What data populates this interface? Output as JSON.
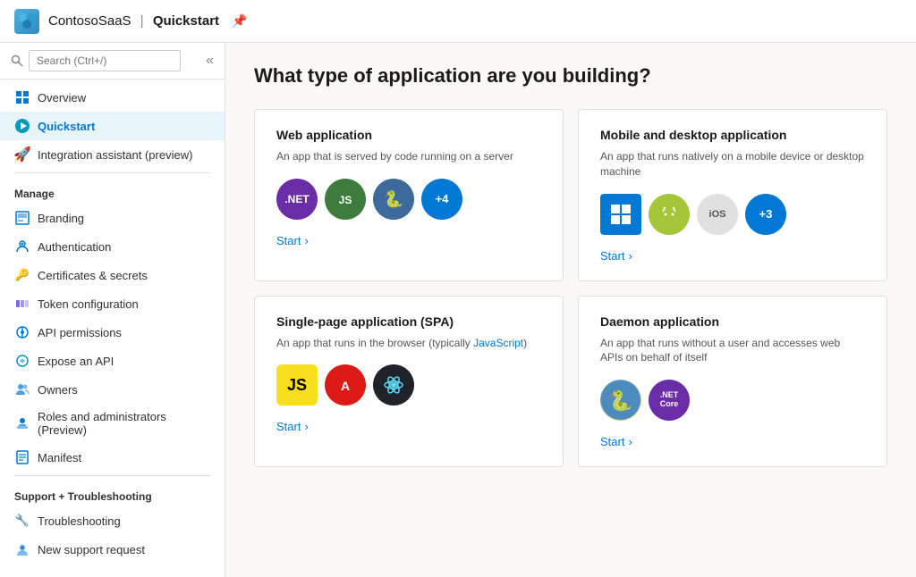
{
  "header": {
    "app_name": "ContosoSaaS",
    "separator": "|",
    "page_name": "Quickstart",
    "pin_icon": "📌"
  },
  "sidebar": {
    "search_placeholder": "Search (Ctrl+/)",
    "collapse_icon": "«",
    "items": [
      {
        "id": "overview",
        "label": "Overview",
        "icon": "grid",
        "active": false
      },
      {
        "id": "quickstart",
        "label": "Quickstart",
        "icon": "quickstart",
        "active": true
      },
      {
        "id": "integration",
        "label": "Integration assistant (preview)",
        "icon": "rocket",
        "active": false
      }
    ],
    "manage_label": "Manage",
    "manage_items": [
      {
        "id": "branding",
        "label": "Branding",
        "icon": "branding"
      },
      {
        "id": "authentication",
        "label": "Authentication",
        "icon": "auth"
      },
      {
        "id": "certificates",
        "label": "Certificates & secrets",
        "icon": "cert"
      },
      {
        "id": "token",
        "label": "Token configuration",
        "icon": "token"
      },
      {
        "id": "api-permissions",
        "label": "API permissions",
        "icon": "api"
      },
      {
        "id": "expose-api",
        "label": "Expose an API",
        "icon": "expose"
      },
      {
        "id": "owners",
        "label": "Owners",
        "icon": "owners"
      },
      {
        "id": "roles",
        "label": "Roles and administrators (Preview)",
        "icon": "roles"
      },
      {
        "id": "manifest",
        "label": "Manifest",
        "icon": "manifest"
      }
    ],
    "support_label": "Support + Troubleshooting",
    "support_items": [
      {
        "id": "troubleshooting",
        "label": "Troubleshooting",
        "icon": "trouble"
      },
      {
        "id": "support",
        "label": "New support request",
        "icon": "support"
      }
    ]
  },
  "main": {
    "title": "What type of application are you building?",
    "cards": [
      {
        "id": "web-app",
        "title": "Web application",
        "desc": "An app that is served by code running on a server",
        "start_label": "Start",
        "icons": [
          {
            "type": "net",
            "label": ".NET"
          },
          {
            "type": "node",
            "label": "JS"
          },
          {
            "type": "python",
            "label": "🐍"
          },
          {
            "type": "more",
            "label": "+4"
          }
        ]
      },
      {
        "id": "mobile-app",
        "title": "Mobile and desktop application",
        "desc": "An app that runs natively on a mobile device or desktop machine",
        "start_label": "Start",
        "icons": [
          {
            "type": "windows",
            "label": "⊞"
          },
          {
            "type": "android",
            "label": "🤖"
          },
          {
            "type": "ios",
            "label": "iOS"
          },
          {
            "type": "more",
            "label": "+3"
          }
        ]
      },
      {
        "id": "spa",
        "title": "Single-page application (SPA)",
        "desc": "An app that runs in the browser (typically JavaScript)",
        "start_label": "Start",
        "icons": [
          {
            "type": "js",
            "label": "JS"
          },
          {
            "type": "angular",
            "label": "A"
          },
          {
            "type": "react",
            "label": "⚛"
          }
        ]
      },
      {
        "id": "daemon",
        "title": "Daemon application",
        "desc": "An app that runs without a user and accesses web APIs on behalf of itself",
        "start_label": "Start",
        "icons": [
          {
            "type": "python2",
            "label": "🐍"
          },
          {
            "type": "netcore",
            "label": ".NET Core"
          }
        ]
      }
    ]
  }
}
